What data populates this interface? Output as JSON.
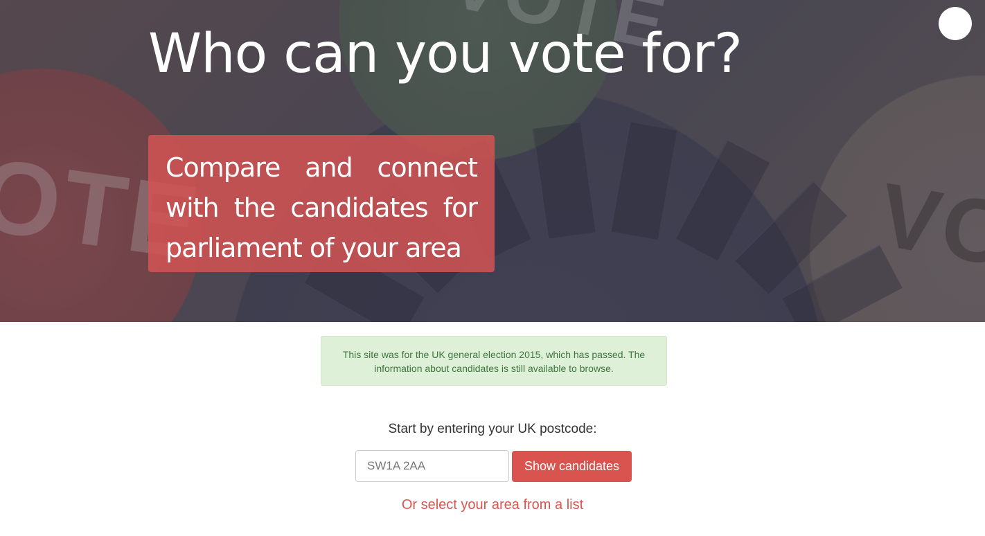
{
  "hero": {
    "title": "Who can you vote for?",
    "tagline": "Compare and connect with the candidates for parliament of your area",
    "background_words": [
      "OTE",
      "VO",
      "VOTE"
    ],
    "accent_color": "#d45454"
  },
  "header": {
    "menu_icon": "circle-menu-icon"
  },
  "notice": {
    "text": "This site was for the UK general election 2015, which has passed. The information about candidates is still available to browse.",
    "color": "#dff0d8"
  },
  "search": {
    "prompt": "Start by entering your UK postcode:",
    "placeholder": "SW1A 2AA",
    "button_label": "Show candidates",
    "button_color": "#d9534f",
    "alt_link": "Or select your area from a list"
  }
}
